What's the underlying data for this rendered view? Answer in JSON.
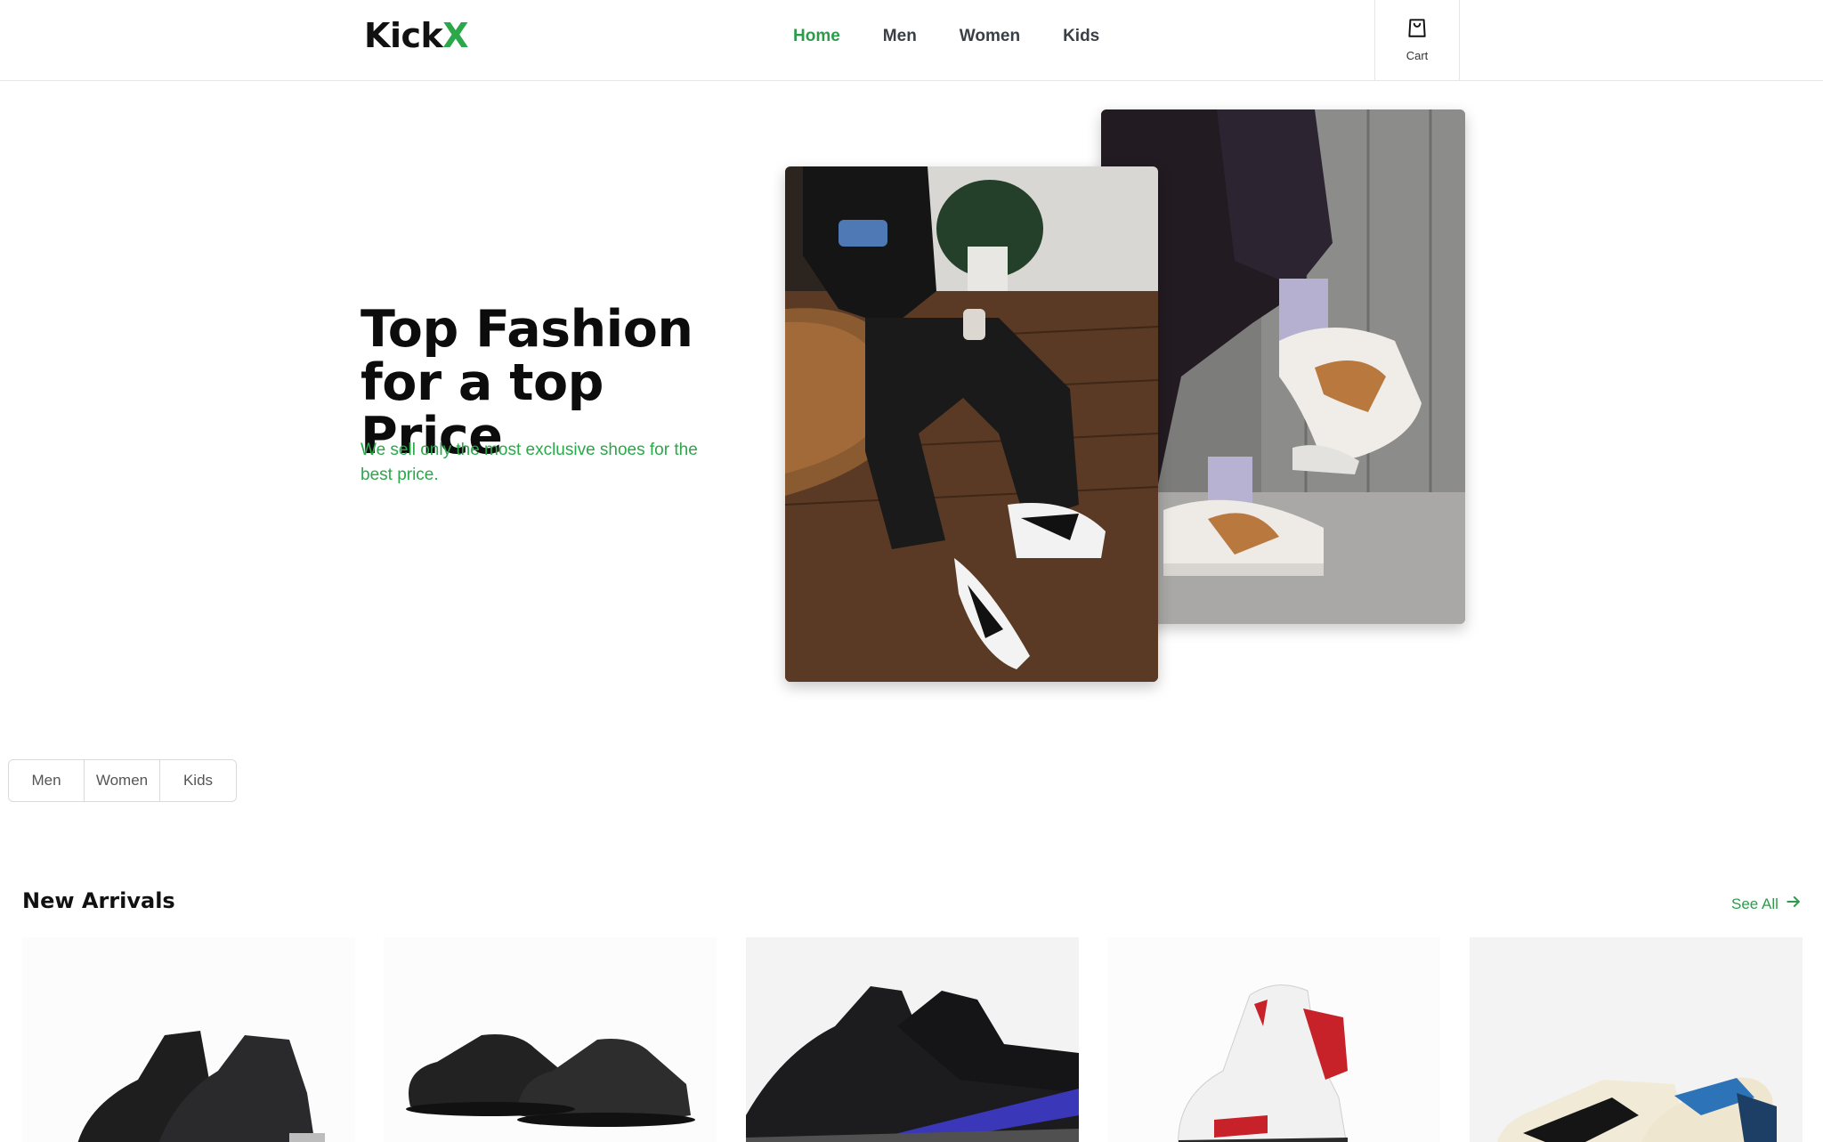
{
  "brand": {
    "name_main": "Kick",
    "name_accent": "X"
  },
  "nav": {
    "items": [
      {
        "label": "Home",
        "active": true
      },
      {
        "label": "Men",
        "active": false
      },
      {
        "label": "Women",
        "active": false
      },
      {
        "label": "Kids",
        "active": false
      }
    ]
  },
  "cart": {
    "label": "Cart",
    "icon": "shopping-bag-icon"
  },
  "hero": {
    "title_line1": "Top Fashion",
    "title_line2": "for a top Price",
    "subtitle": "We sell only the most exclusive shoes for the best price.",
    "images": [
      "lifestyle-photo-orange-white-sneakers",
      "lifestyle-photo-black-white-high-tops"
    ]
  },
  "segments": {
    "items": [
      "Men",
      "Women",
      "Kids"
    ]
  },
  "new_arrivals": {
    "title": "New Arrivals",
    "see_all": "See All",
    "see_all_icon": "arrow-right-icon",
    "products": [
      "black-high-top-sneaker",
      "black-low-runner-sneaker",
      "black-blue-knit-sneaker",
      "white-red-high-top-sneaker",
      "cream-black-blue-low-sneaker"
    ]
  },
  "colors": {
    "accent": "#2aa84a",
    "nav_active": "#2e9b4c",
    "text": "#111111",
    "border": "#d9d9d9"
  }
}
